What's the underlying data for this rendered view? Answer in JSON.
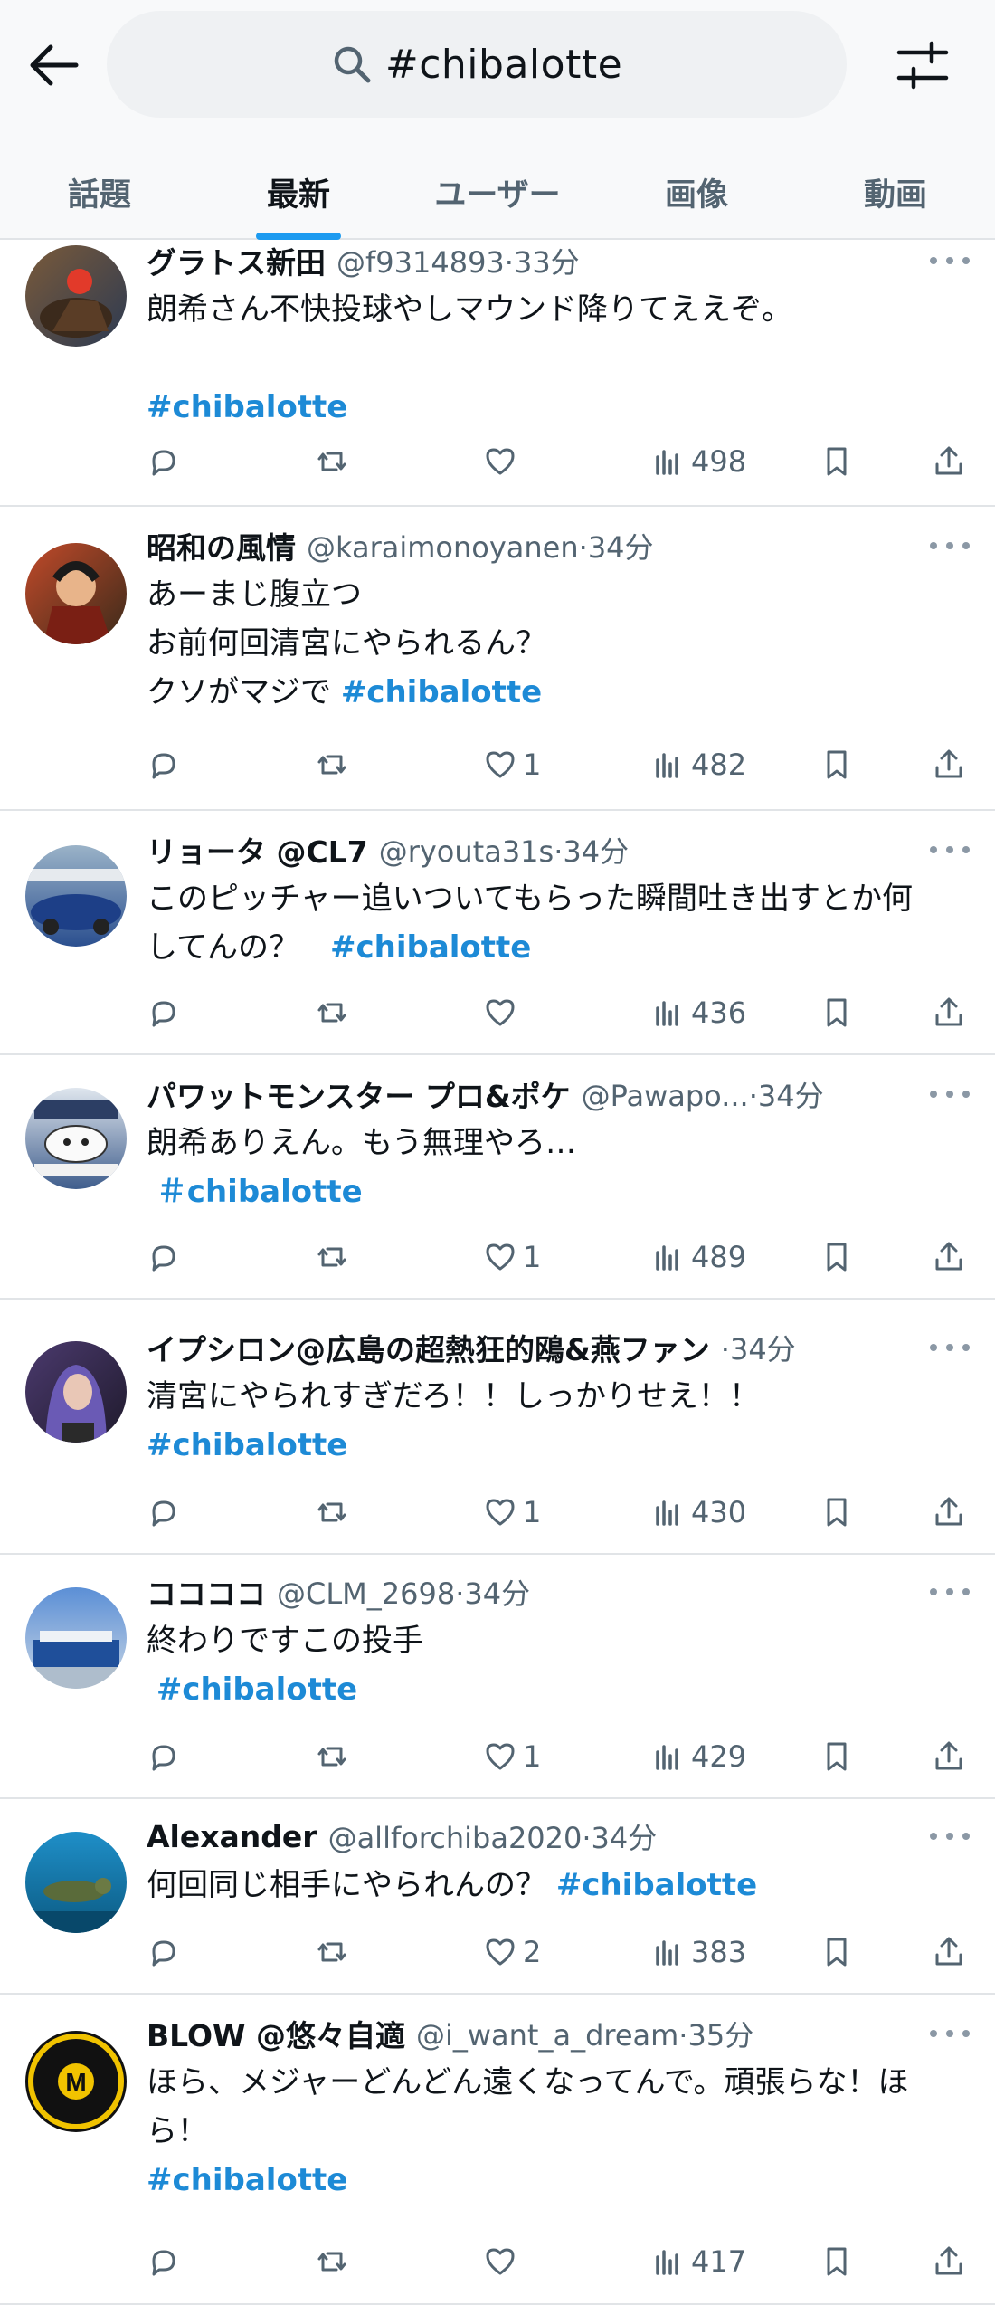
{
  "search": {
    "query": "#chibalotte"
  },
  "tabs": [
    {
      "label": "話題"
    },
    {
      "label": "最新"
    },
    {
      "label": "ユーザー"
    },
    {
      "label": "画像"
    },
    {
      "label": "動画"
    }
  ],
  "active_tab": 1,
  "colors": {
    "accent": "#1d9bf0",
    "hashtag": "#1d8ad6",
    "muted": "#536471"
  },
  "tweets": [
    {
      "name": "グラトス新田",
      "handle": "@f9314893",
      "time": "33分",
      "lines": [
        {
          "text": "朗希さん不快投球やしマウンド降りてええぞ。",
          "tag": ""
        },
        {
          "text": "",
          "tag": ""
        },
        {
          "text": "",
          "tag": "#chibalotte"
        }
      ],
      "likes": "",
      "views": "498"
    },
    {
      "name": "昭和の風情",
      "handle": "@karaimonoyanen",
      "time": "34分",
      "lines": [
        {
          "text": "あーまじ腹立つ",
          "tag": ""
        },
        {
          "text": "お前何回清宮にやられるん？",
          "tag": ""
        },
        {
          "text": "クソがマジで ",
          "tag": "#chibalotte"
        }
      ],
      "likes": "1",
      "views": "482"
    },
    {
      "name": "リョータ @CL7",
      "handle": "@ryouta31s",
      "time": "34分",
      "lines": [
        {
          "text": "このピッチャー追いついてもらった瞬間吐き出すとか何",
          "tag": ""
        },
        {
          "text": "してんの？　",
          "tag": "#chibalotte"
        }
      ],
      "likes": "",
      "views": "436"
    },
    {
      "name": "パワットモンスター プロ&ポケ",
      "handle": "@Pawapo...",
      "time": "34分",
      "lines": [
        {
          "text": "朗希ありえん。もう無理やろ…",
          "tag": ""
        },
        {
          "text": " ",
          "tag": "＃chibalotte"
        }
      ],
      "likes": "1",
      "views": "489"
    },
    {
      "name": "イプシロン@広島の超熱狂的鴎&燕ファン",
      "handle": "",
      "time": "34分",
      "lines": [
        {
          "text": "清宮にやられすぎだろ！！しっかりせえ！！",
          "tag": ""
        },
        {
          "text": "",
          "tag": "#chibalotte"
        }
      ],
      "likes": "1",
      "views": "430"
    },
    {
      "name": "ココココ",
      "handle": "@CLM_2698",
      "time": "34分",
      "lines": [
        {
          "text": "終わりですこの投手",
          "tag": ""
        },
        {
          "text": " ",
          "tag": "#chibalotte"
        }
      ],
      "likes": "1",
      "views": "429"
    },
    {
      "name": "Alexander",
      "handle": "@allforchiba2020",
      "time": "34分",
      "lines": [
        {
          "text": "何回同じ相手にやられんの？ ",
          "tag": "#chibalotte"
        }
      ],
      "likes": "2",
      "views": "383"
    },
    {
      "name": "BLOW @悠々自適",
      "handle": "@i_want_a_dream",
      "time": "35分",
      "lines": [
        {
          "text": "ほら、メジャーどんどん遠くなってんで。頑張らな！ほ",
          "tag": ""
        },
        {
          "text": "ら！",
          "tag": ""
        },
        {
          "text": "",
          "tag": "#chibalotte"
        }
      ],
      "likes": "",
      "views": "417"
    }
  ]
}
